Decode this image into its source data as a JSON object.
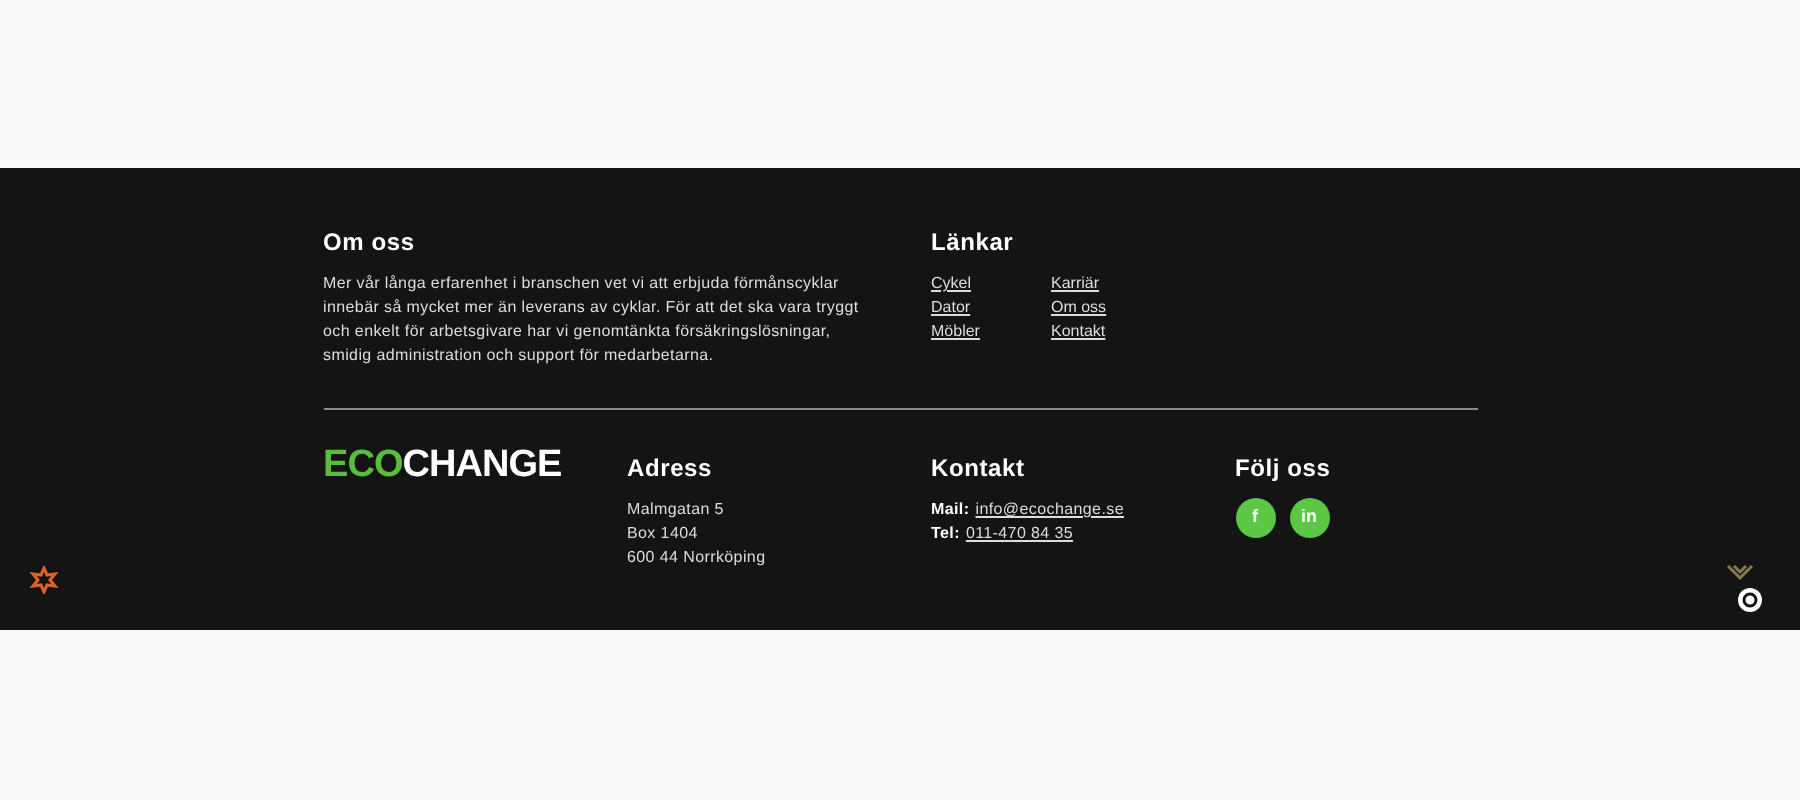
{
  "about": {
    "heading": "Om oss",
    "text": "Mer vår långa erfarenhet i branschen vet vi att erbjuda förmånscyklar innebär så mycket mer än leverans av cyklar. För att det ska vara tryggt och enkelt för arbetsgivare har vi genomtänkta försäkringslösningar, smidig administration och support för medarbetarna."
  },
  "links": {
    "heading": "Länkar",
    "items": [
      "Cykel",
      "Dator",
      "Möbler",
      "Karriär",
      "Om oss",
      "Kontakt"
    ]
  },
  "logo": {
    "green": "ECO",
    "white": "CHANGE"
  },
  "address": {
    "heading": "Adress",
    "lines": [
      "Malmgatan 5",
      "Box 1404",
      "600 44 Norrköping"
    ]
  },
  "contact": {
    "heading": "Kontakt",
    "rows": [
      {
        "label": "Mail:",
        "value": "info@ecochange.se"
      },
      {
        "label": "Tel:",
        "value": "011-470 84 35"
      }
    ]
  },
  "social": {
    "heading": "Följ oss",
    "items": [
      {
        "glyph": "f"
      },
      {
        "glyph": "in"
      }
    ]
  }
}
